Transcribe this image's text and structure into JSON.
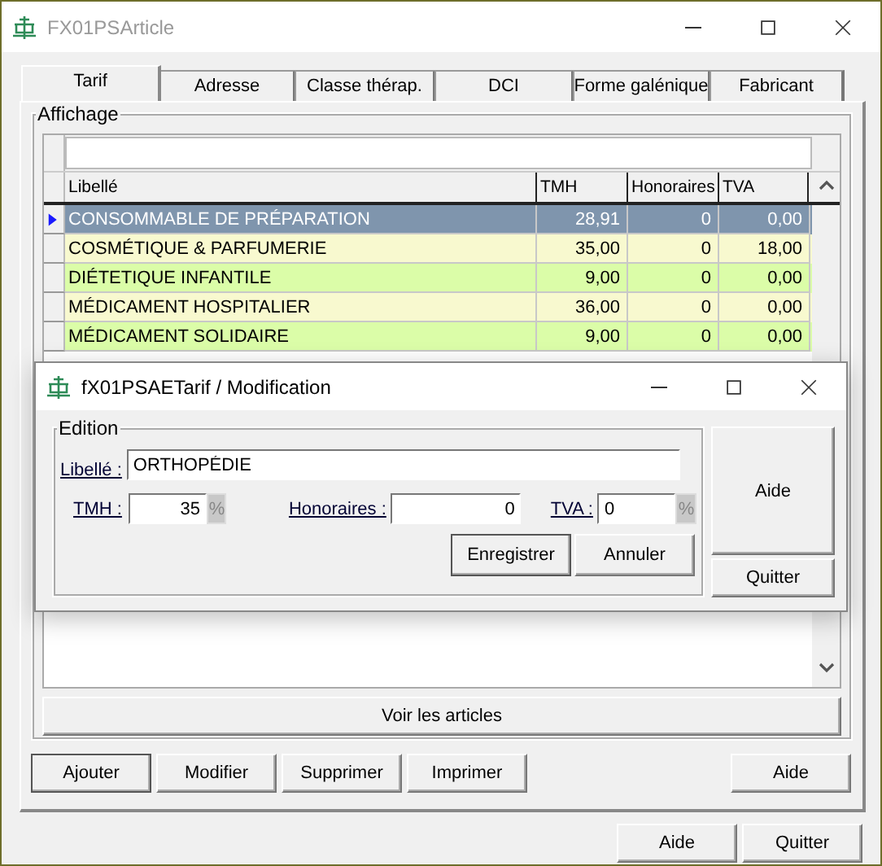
{
  "window": {
    "title": "FX01PSArticle"
  },
  "tabs": [
    {
      "label": "Tarif",
      "selected": true
    },
    {
      "label": "Adresse",
      "selected": false
    },
    {
      "label": "Classe thérap.",
      "selected": false
    },
    {
      "label": "DCI",
      "selected": false
    },
    {
      "label": "Forme galénique",
      "selected": false
    },
    {
      "label": "Fabricant",
      "selected": false
    }
  ],
  "group": {
    "title": "Affichage"
  },
  "table": {
    "columns": [
      "Libellé",
      "TMH",
      "Honoraires",
      "TVA"
    ],
    "rows": [
      {
        "cells": [
          "CONSOMMABLE DE PRÉPARATION",
          "28,91",
          "0",
          "0,00"
        ],
        "selected": true
      },
      {
        "cells": [
          "COSMÉTIQUE & PARFUMERIE",
          "35,00",
          "0",
          "18,00"
        ],
        "selected": false
      },
      {
        "cells": [
          "DIÉTETIQUE INFANTILE",
          "9,00",
          "0",
          "0,00"
        ],
        "selected": false
      },
      {
        "cells": [
          "MÉDICAMENT HOSPITALIER",
          "36,00",
          "0",
          "0,00"
        ],
        "selected": false
      },
      {
        "cells": [
          "MÉDICAMENT SOLIDAIRE",
          "9,00",
          "0",
          "0,00"
        ],
        "selected": false
      }
    ]
  },
  "view_button": "Voir les articles",
  "tab_buttons": [
    "Ajouter",
    "Modifier",
    "Supprimer",
    "Imprimer"
  ],
  "tab_help": "Aide",
  "window_buttons": [
    "Aide",
    "Quitter"
  ],
  "dialog": {
    "title": "fX01PSAETarif / Modification",
    "group": "Edition",
    "label_field": {
      "label": "Libellé :",
      "value": "ORTHOPÉDIE"
    },
    "fields": [
      {
        "label": "TMH :",
        "value": "35",
        "unit": "%"
      },
      {
        "label": "Honoraires :",
        "value": "0"
      },
      {
        "label": "TVA :",
        "value": "0",
        "unit": "%"
      }
    ],
    "buttons": [
      "Enregistrer",
      "Annuler"
    ],
    "side_buttons": [
      "Aide",
      "Quitter"
    ]
  }
}
